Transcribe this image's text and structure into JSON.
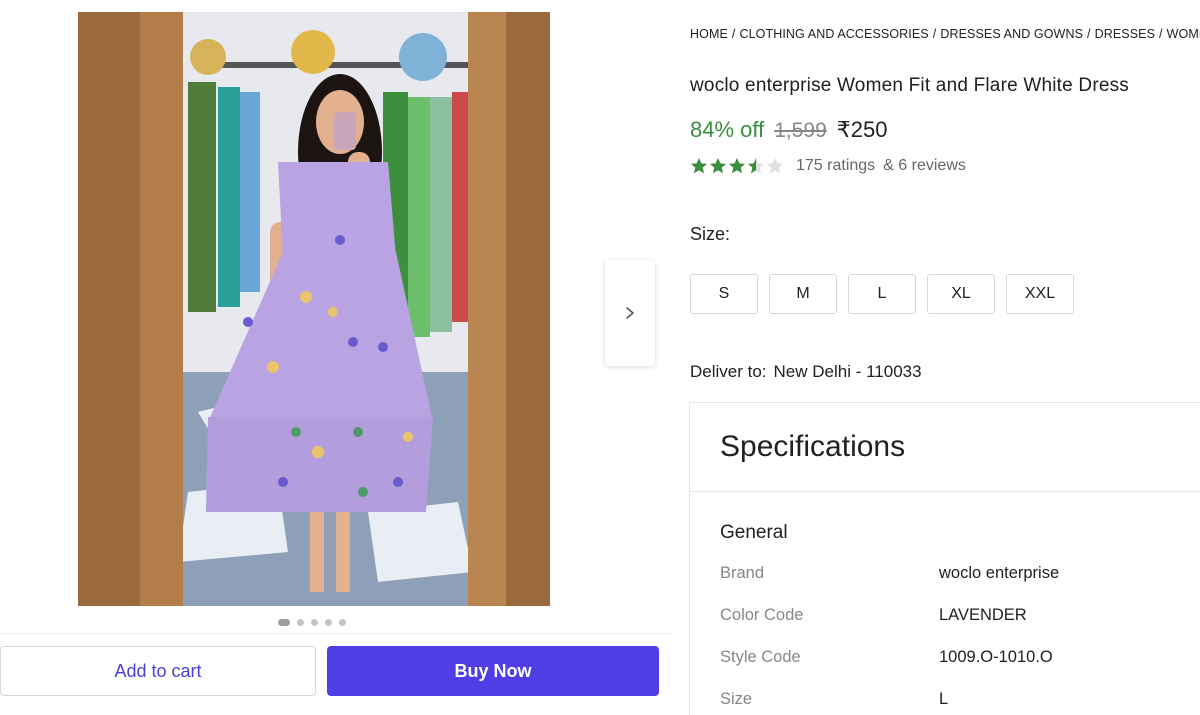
{
  "breadcrumb": [
    "HOME",
    "CLOTHING AND ACCESSORIES",
    "DRESSES AND GOWNS",
    "DRESSES",
    "WOMEN'S DRESSES"
  ],
  "product": {
    "title": "woclo enterprise Women Fit and Flare White Dress",
    "discount": "84% off",
    "mrp": "1,599",
    "price": "₹250",
    "rating_value": 3.5,
    "ratings_text": "175 ratings",
    "reviews_text": "& 6 reviews"
  },
  "size": {
    "label": "Size:",
    "options": [
      "S",
      "M",
      "L",
      "XL",
      "XXL"
    ]
  },
  "delivery": {
    "label": "Deliver to:",
    "location": "New Delhi - 110033"
  },
  "specifications": {
    "title": "Specifications",
    "section": "General",
    "rows": [
      {
        "key": "Brand",
        "value": "woclo enterprise"
      },
      {
        "key": "Color Code",
        "value": "LAVENDER"
      },
      {
        "key": "Style Code",
        "value": "1009.O-1010.O"
      },
      {
        "key": "Size",
        "value": "L"
      }
    ]
  },
  "carousel": {
    "total_images": 5,
    "active_index": 0
  },
  "actions": {
    "add_to_cart": "Add to cart",
    "buy_now": "Buy Now"
  },
  "colors": {
    "accent": "#4f3ee6",
    "discount_green": "#388e3c",
    "star_green": "#388e3c",
    "dress_lavender": "#b9a3e3"
  },
  "icons": {
    "carousel_next": "chevron-right-icon",
    "star": "star-icon"
  }
}
